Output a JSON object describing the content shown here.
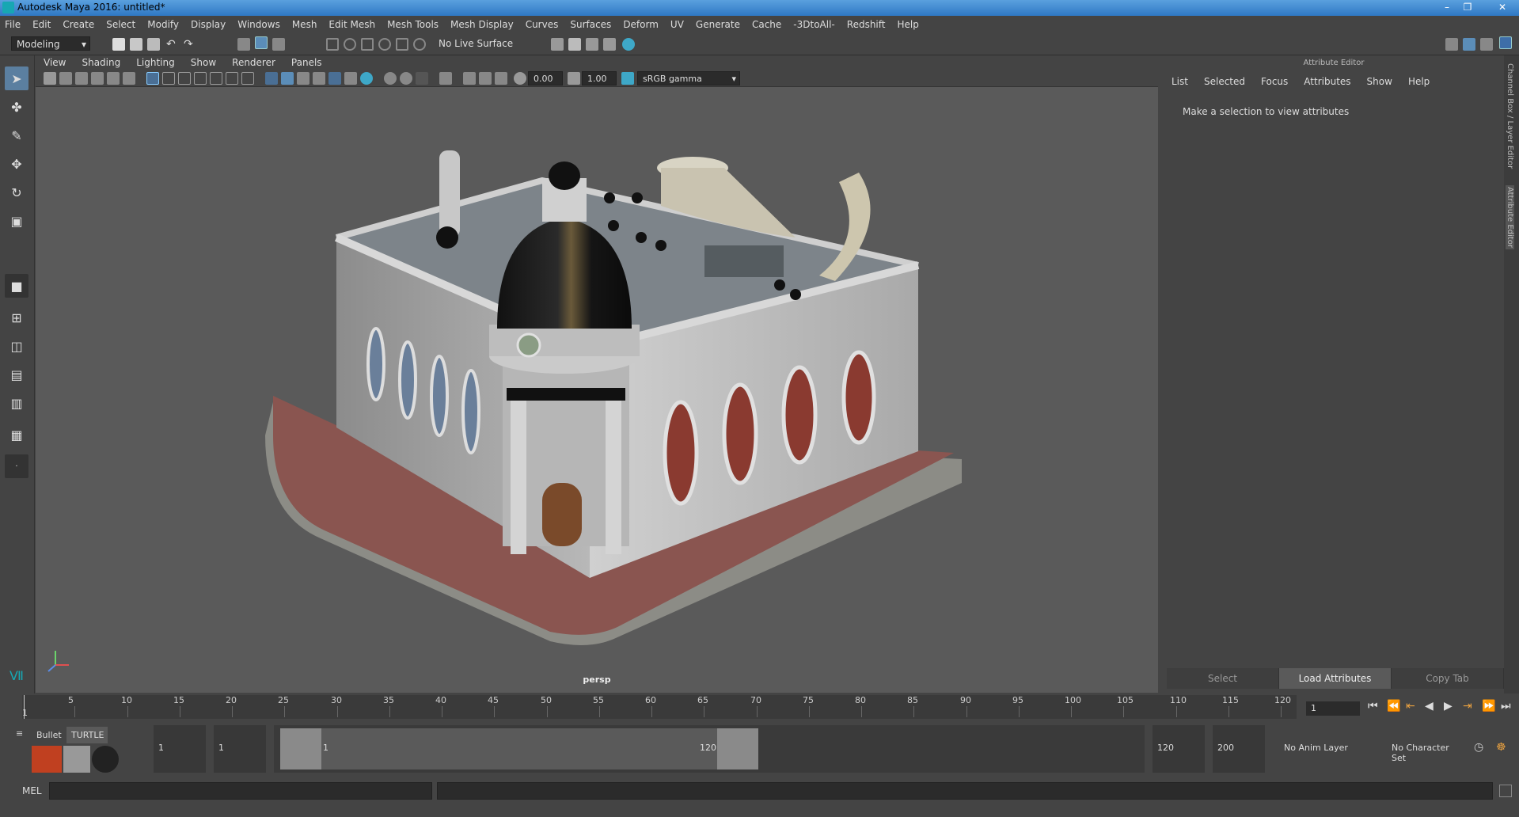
{
  "window": {
    "title": "Autodesk Maya 2016: untitled*"
  },
  "menubar": [
    "File",
    "Edit",
    "Create",
    "Select",
    "Modify",
    "Display",
    "Windows",
    "Mesh",
    "Edit Mesh",
    "Mesh Tools",
    "Mesh Display",
    "Curves",
    "Surfaces",
    "Deform",
    "UV",
    "Generate",
    "Cache",
    "-3DtoAll-",
    "Redshift",
    "Help"
  ],
  "shelf": {
    "mode": "Modeling",
    "live_surface": "No Live Surface"
  },
  "viewport": {
    "menu": [
      "View",
      "Shading",
      "Lighting",
      "Show",
      "Renderer",
      "Panels"
    ],
    "exposure": "0.00",
    "gamma": "1.00",
    "color_space": "sRGB gamma",
    "camera": "persp"
  },
  "attribute_editor": {
    "header": "Attribute Editor",
    "menu": [
      "List",
      "Selected",
      "Focus",
      "Attributes",
      "Show",
      "Help"
    ],
    "message": "Make a selection to view attributes",
    "buttons": [
      "Select",
      "Load Attributes",
      "Copy Tab"
    ]
  },
  "side_tabs": {
    "channel_box": "Channel Box / Layer Editor",
    "attribute_editor": "Attribute Editor"
  },
  "timeline": {
    "ticks": [
      "5",
      "10",
      "15",
      "20",
      "25",
      "30",
      "35",
      "40",
      "45",
      "50",
      "55",
      "60",
      "65",
      "70",
      "75",
      "80",
      "85",
      "90",
      "95",
      "100",
      "105",
      "110",
      "115",
      "120"
    ],
    "current_frame": "1",
    "start_marker": "1"
  },
  "range": {
    "start": "1",
    "playback_start": "1",
    "range_start_label": "1",
    "range_end_label": "120",
    "playback_end": "120",
    "end": "200",
    "anim_layer": "No Anim Layer",
    "character_set": "No Character Set",
    "shelf_tabs": [
      "Bullet",
      "TURTLE"
    ]
  },
  "command_line": {
    "label": "MEL"
  }
}
